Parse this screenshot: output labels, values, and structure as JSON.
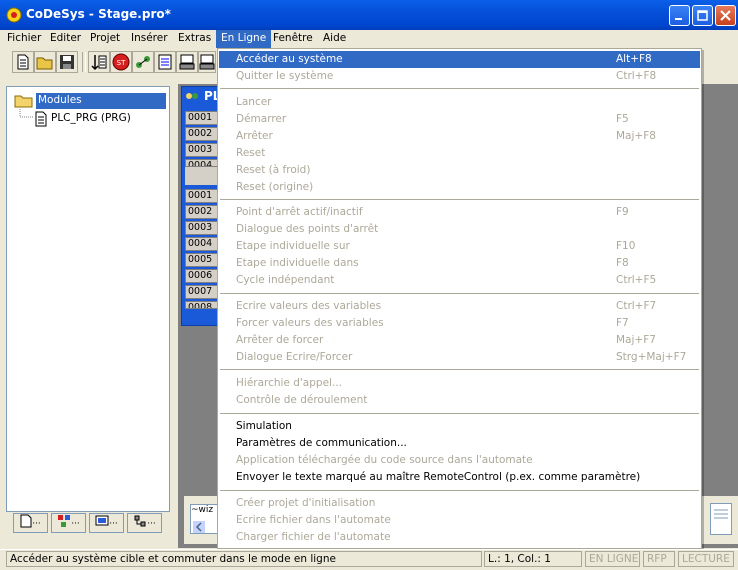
{
  "window": {
    "title": "CoDeSys - Stage.pro*",
    "minimize_icon": "minimize-icon",
    "maximize_icon": "maximize-icon",
    "close_icon": "close-icon"
  },
  "menubar": {
    "items": [
      {
        "label": "Fichier"
      },
      {
        "label": "Editer"
      },
      {
        "label": "Projet"
      },
      {
        "label": "Insérer"
      },
      {
        "label": "Extras"
      },
      {
        "label": "En Ligne"
      },
      {
        "label": "Fenêtre"
      },
      {
        "label": "Aide"
      }
    ],
    "active": "En Ligne"
  },
  "toolbar": {
    "icons": [
      "new-file-icon",
      "open-folder-icon",
      "save-icon",
      "build-icon",
      "stop-icon",
      "run-icon",
      "step-icon",
      "login-icon",
      "logout-icon"
    ]
  },
  "tree": {
    "root_label": "Modules",
    "child_label": "PLC_PRG (PRG)"
  },
  "left_tabs": [
    {
      "icon": "pou-tab-icon",
      "label": "..."
    },
    {
      "icon": "datatypes-tab-icon",
      "label": "..."
    },
    {
      "icon": "visualization-tab-icon",
      "label": "..."
    },
    {
      "icon": "resources-tab-icon",
      "label": "..."
    }
  ],
  "editor": {
    "title_fragment": "PL",
    "top_lines": [
      "0001",
      "0002",
      "0003",
      "0004"
    ],
    "bottom_lines": [
      "0001",
      "0002",
      "0003",
      "0004",
      "0005",
      "0006",
      "0007",
      "0008"
    ]
  },
  "watch": {
    "input_value": "~wiz"
  },
  "dropdown": {
    "groups": [
      [
        {
          "label": "Accéder au système",
          "shortcut": "Alt+F8",
          "enabled": true,
          "highlighted": true
        },
        {
          "label": "Quitter le système",
          "shortcut": "Ctrl+F8",
          "enabled": false
        }
      ],
      [
        {
          "label": "Lancer",
          "shortcut": "",
          "enabled": false
        },
        {
          "label": "Démarrer",
          "shortcut": "F5",
          "enabled": false
        },
        {
          "label": "Arrêter",
          "shortcut": "Maj+F8",
          "enabled": false
        },
        {
          "label": "Reset",
          "shortcut": "",
          "enabled": false
        },
        {
          "label": "Reset (à froid)",
          "shortcut": "",
          "enabled": false
        },
        {
          "label": "Reset (origine)",
          "shortcut": "",
          "enabled": false
        }
      ],
      [
        {
          "label": "Point d'arrêt actif/inactif",
          "shortcut": "F9",
          "enabled": false
        },
        {
          "label": "Dialogue des points d'arrêt",
          "shortcut": "",
          "enabled": false
        },
        {
          "label": "Etape individuelle sur",
          "shortcut": "F10",
          "enabled": false
        },
        {
          "label": "Etape individuelle dans",
          "shortcut": "F8",
          "enabled": false
        },
        {
          "label": "Cycle indépendant",
          "shortcut": "Ctrl+F5",
          "enabled": false
        }
      ],
      [
        {
          "label": "Ecrire valeurs des variables",
          "shortcut": "Ctrl+F7",
          "enabled": false
        },
        {
          "label": "Forcer valeurs des variables",
          "shortcut": "F7",
          "enabled": false
        },
        {
          "label": "Arrêter de forcer",
          "shortcut": "Maj+F7",
          "enabled": false
        },
        {
          "label": "Dialogue Ecrire/Forcer",
          "shortcut": "Strg+Maj+F7",
          "enabled": false
        }
      ],
      [
        {
          "label": "Hiérarchie d'appel...",
          "shortcut": "",
          "enabled": false
        },
        {
          "label": "Contrôle de déroulement",
          "shortcut": "",
          "enabled": false
        }
      ],
      [
        {
          "label": "Simulation",
          "shortcut": "",
          "enabled": true
        },
        {
          "label": "Paramètres de communication...",
          "shortcut": "",
          "enabled": true
        },
        {
          "label": "Application téléchargée du code source dans l'automate",
          "shortcut": "",
          "enabled": false
        },
        {
          "label": "Envoyer le texte marqué au maître RemoteControl  (p.ex. comme paramètre)",
          "shortcut": "",
          "enabled": true
        }
      ],
      [
        {
          "label": "Créer projet d'initialisation",
          "shortcut": "",
          "enabled": false
        },
        {
          "label": "Ecrire fichier dans l'automate",
          "shortcut": "",
          "enabled": false
        },
        {
          "label": "Charger fichier de l'automate",
          "shortcut": "",
          "enabled": false
        }
      ]
    ]
  },
  "statusbar": {
    "message": "Accéder au système cible et commuter dans le mode en ligne",
    "position": "L.: 1, Col.: 1",
    "online": "EN LIGNE",
    "rfp": "RFP",
    "lecture": "LECTURE"
  }
}
